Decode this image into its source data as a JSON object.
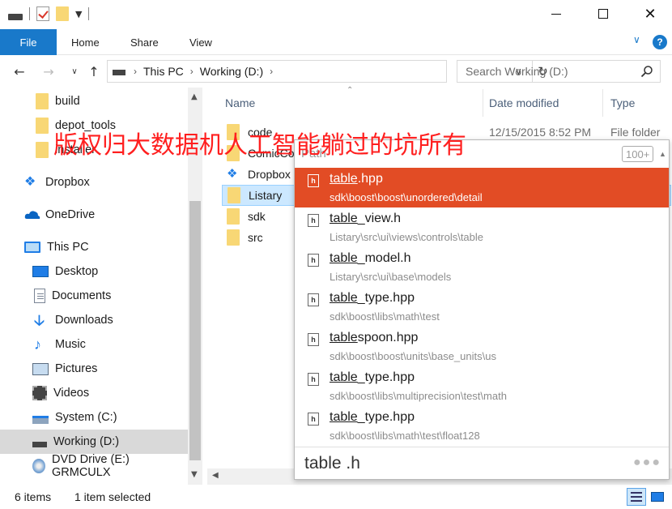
{
  "ribbon": {
    "file": "File",
    "home": "Home",
    "share": "Share",
    "view": "View"
  },
  "address": {
    "this_pc": "This PC",
    "drive": "Working (D:)"
  },
  "search": {
    "placeholder": "Search Working (D:)"
  },
  "nav": {
    "items": [
      {
        "label": "build",
        "icon": "folder-icon"
      },
      {
        "label": "depot_tools",
        "icon": "folder-icon"
      },
      {
        "label": "installer",
        "icon": "folder-icon"
      },
      {
        "label": "Dropbox",
        "icon": "dropbox-icon"
      },
      {
        "label": "OneDrive",
        "icon": "onedrive-icon"
      },
      {
        "label": "This PC",
        "icon": "computer-icon"
      },
      {
        "label": "Desktop",
        "icon": "desktop-icon"
      },
      {
        "label": "Documents",
        "icon": "documents-icon"
      },
      {
        "label": "Downloads",
        "icon": "downloads-icon"
      },
      {
        "label": "Music",
        "icon": "music-icon"
      },
      {
        "label": "Pictures",
        "icon": "pictures-icon"
      },
      {
        "label": "Videos",
        "icon": "videos-icon"
      },
      {
        "label": "System (C:)",
        "icon": "system-drive-icon"
      },
      {
        "label": "Working (D:)",
        "icon": "drive-icon",
        "selected": true
      },
      {
        "label": "DVD Drive (E:) GRMCULX",
        "icon": "dvd-icon"
      }
    ]
  },
  "columns": {
    "name": "Name",
    "date": "Date modified",
    "type": "Type"
  },
  "files": [
    {
      "name": "code",
      "date": "12/15/2015 8:52 PM",
      "type": "File folder"
    },
    {
      "name": "ComicCo"
    },
    {
      "name": "Dropbox"
    },
    {
      "name": "Listary"
    },
    {
      "name": "sdk"
    },
    {
      "name": "src"
    }
  ],
  "status": {
    "count": "6 items",
    "selected": "1 item selected"
  },
  "popup": {
    "path_label": "Path",
    "count": "100+",
    "query": "table .h",
    "results": [
      {
        "match": "table",
        "rest": ".hpp",
        "path": "sdk\\boost\\boost\\unordered\\detail",
        "active": true
      },
      {
        "match": "table",
        "rest": "_view.h",
        "path": "Listary\\src\\ui\\views\\controls\\table"
      },
      {
        "match": "table",
        "rest": "_model.h",
        "path": "Listary\\src\\ui\\base\\models"
      },
      {
        "match": "table",
        "rest": "_type.hpp",
        "path": "sdk\\boost\\libs\\math\\test"
      },
      {
        "match": "table",
        "rest": "spoon.hpp",
        "path": "sdk\\boost\\boost\\units\\base_units\\us"
      },
      {
        "match": "table",
        "rest": "_type.hpp",
        "path": "sdk\\boost\\libs\\multiprecision\\test\\math"
      },
      {
        "match": "table",
        "rest": "_type.hpp",
        "path": "sdk\\boost\\libs\\math\\test\\float128"
      }
    ]
  },
  "watermark": "版权归大数据机人工智能躺过的坑所有",
  "colors": {
    "accent": "#1979ca",
    "popup_active": "#e24c25",
    "watermark": "#ff1f1f",
    "selection": "#cce8ff"
  }
}
